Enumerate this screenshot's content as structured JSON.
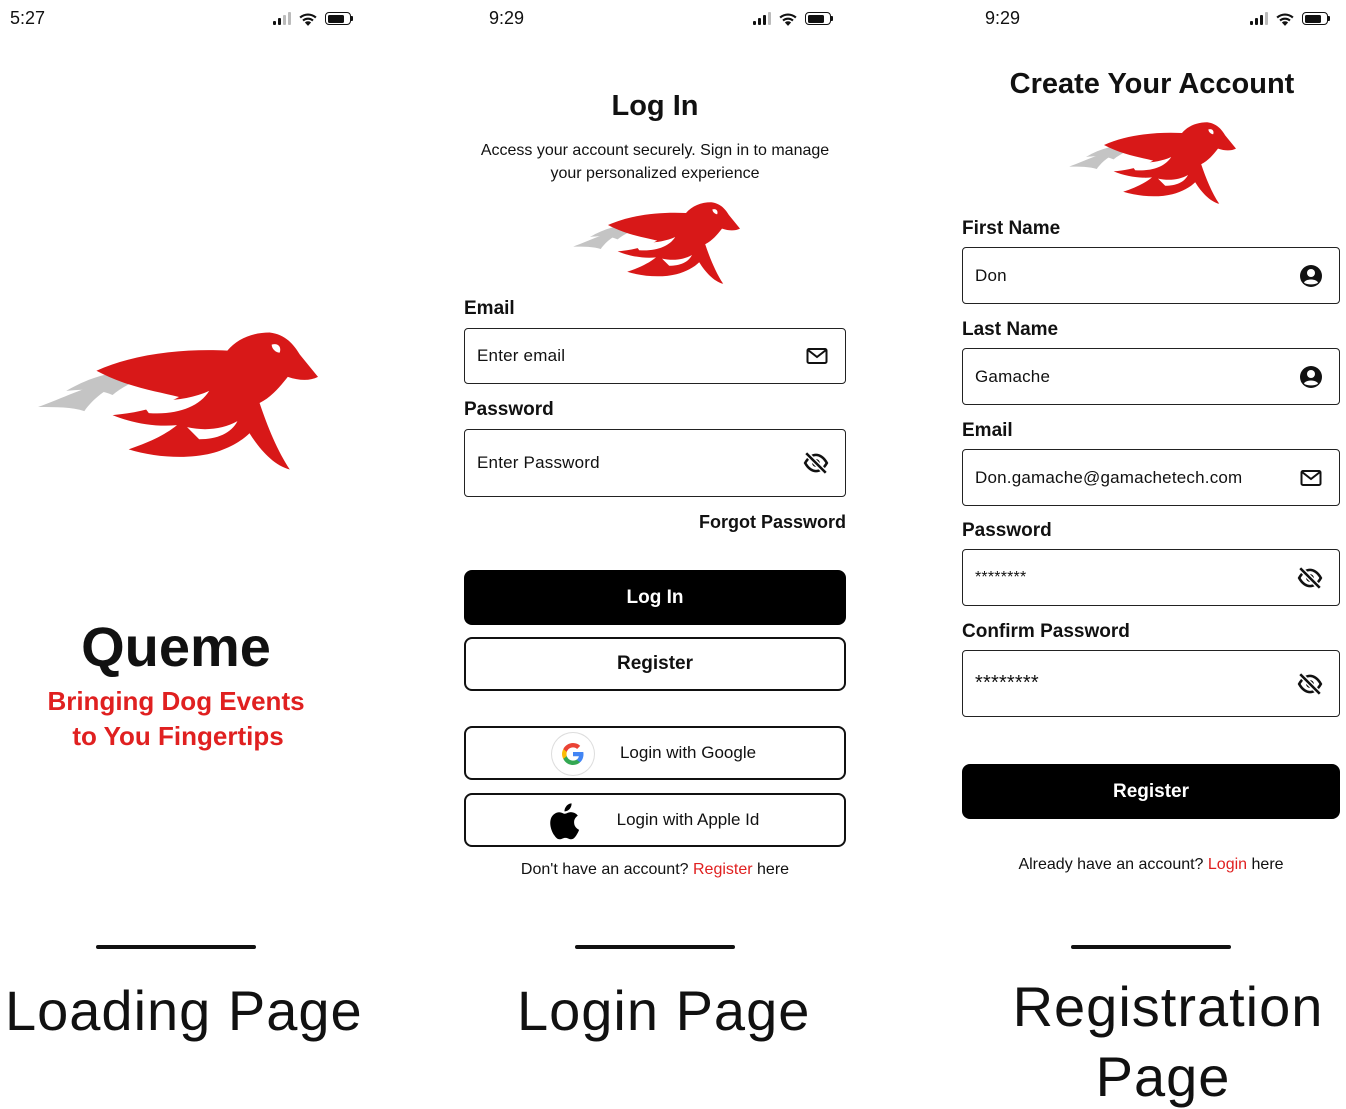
{
  "screens": {
    "loading": {
      "status_time": "5:27",
      "app_name": "Queme",
      "tagline_line1": "Bringing Dog Events",
      "tagline_line2": "to You Fingertips",
      "caption": "Loading Page"
    },
    "login": {
      "status_time": "9:29",
      "title": "Log In",
      "subtitle_line1": "Access your account securely. Sign in to manage",
      "subtitle_line2": "your personalized experience",
      "email_label": "Email",
      "email_placeholder": "Enter email",
      "password_label": "Password",
      "password_placeholder": "Enter Password",
      "forgot_password": "Forgot Password",
      "login_button": "Log In",
      "register_button": "Register",
      "google_button": "Login with Google",
      "apple_button": "Login with Apple Id",
      "footer_prefix": "Don't have an account?",
      "footer_link": "Register",
      "footer_suffix": "here",
      "caption": "Login Page"
    },
    "registration": {
      "status_time": "9:29",
      "title": "Create Your Account",
      "first_name_label": "First Name",
      "first_name_value": "Don",
      "last_name_label": "Last Name",
      "last_name_value": "Gamache",
      "email_label": "Email",
      "email_value": "Don.gamache@gamachetech.com",
      "password_label": "Password",
      "password_value": "********",
      "confirm_label": "Confirm Password",
      "confirm_value": "********",
      "register_button": "Register",
      "footer_prefix": "Already have an account?",
      "footer_link": "Login",
      "footer_suffix": "here",
      "caption_line1": "Registration",
      "caption_line2": "Page"
    }
  },
  "colors": {
    "accent_red": "#e02020",
    "logo_red": "#d81818",
    "logo_gray": "#c4c4c4",
    "button_black": "#000000"
  },
  "icons": {
    "email": "envelope-icon",
    "password_hidden": "eye-slash-icon",
    "user": "user-circle-icon",
    "google": "google-logo-icon",
    "apple": "apple-logo-icon",
    "logo": "running-dog-logo"
  }
}
